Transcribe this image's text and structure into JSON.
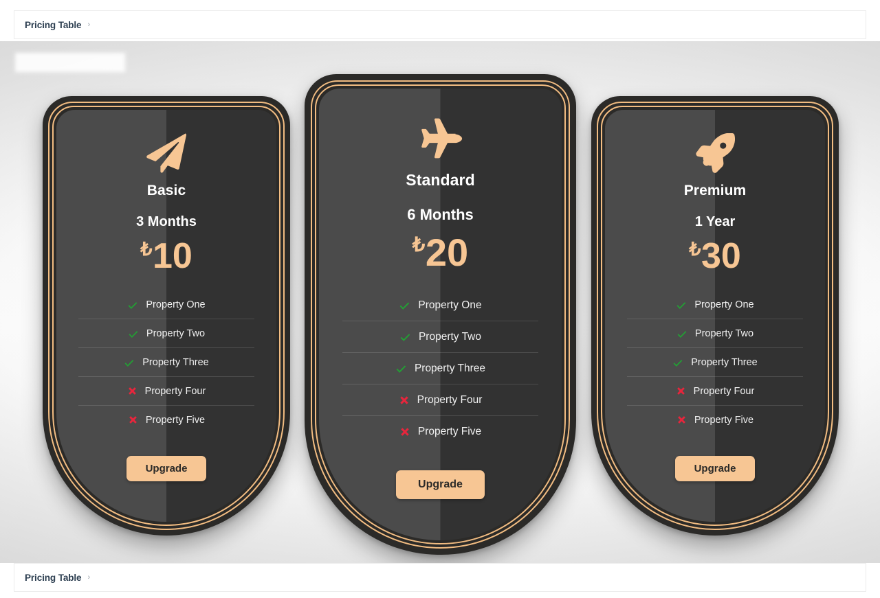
{
  "header": {
    "title": "Pricing Table",
    "chevron": "chevron-right-icon"
  },
  "footer": {
    "title": "Pricing Table",
    "chevron": "chevron-right-icon"
  },
  "colors": {
    "gold": "#f3bd82",
    "accent": "#f7c694",
    "card_frame": "#2b2a28",
    "card_body_light": "#4b4b4b",
    "card_body_dark": "#323232",
    "check": "#22a034",
    "cross": "#e8253c",
    "breadcrumb_text": "#2c3e50"
  },
  "plans": [
    {
      "icon": "paper-plane-icon",
      "name": "Basic",
      "duration": "3 Months",
      "currency": "₺",
      "price": "10",
      "button": "Upgrade",
      "features": [
        {
          "label": "Property One",
          "included": true
        },
        {
          "label": "Property Two",
          "included": true
        },
        {
          "label": "Property Three",
          "included": true
        },
        {
          "label": "Property Four",
          "included": false
        },
        {
          "label": "Property Five",
          "included": false
        }
      ]
    },
    {
      "icon": "airplane-icon",
      "name": "Standard",
      "duration": "6 Months",
      "currency": "₺",
      "price": "20",
      "button": "Upgrade",
      "features": [
        {
          "label": "Property One",
          "included": true
        },
        {
          "label": "Property Two",
          "included": true
        },
        {
          "label": "Property Three",
          "included": true
        },
        {
          "label": "Property Four",
          "included": false
        },
        {
          "label": "Property Five",
          "included": false
        }
      ]
    },
    {
      "icon": "rocket-icon",
      "name": "Premium",
      "duration": "1 Year",
      "currency": "₺",
      "price": "30",
      "button": "Upgrade",
      "features": [
        {
          "label": "Property One",
          "included": true
        },
        {
          "label": "Property Two",
          "included": true
        },
        {
          "label": "Property Three",
          "included": true
        },
        {
          "label": "Property Four",
          "included": false
        },
        {
          "label": "Property Five",
          "included": false
        }
      ]
    }
  ]
}
